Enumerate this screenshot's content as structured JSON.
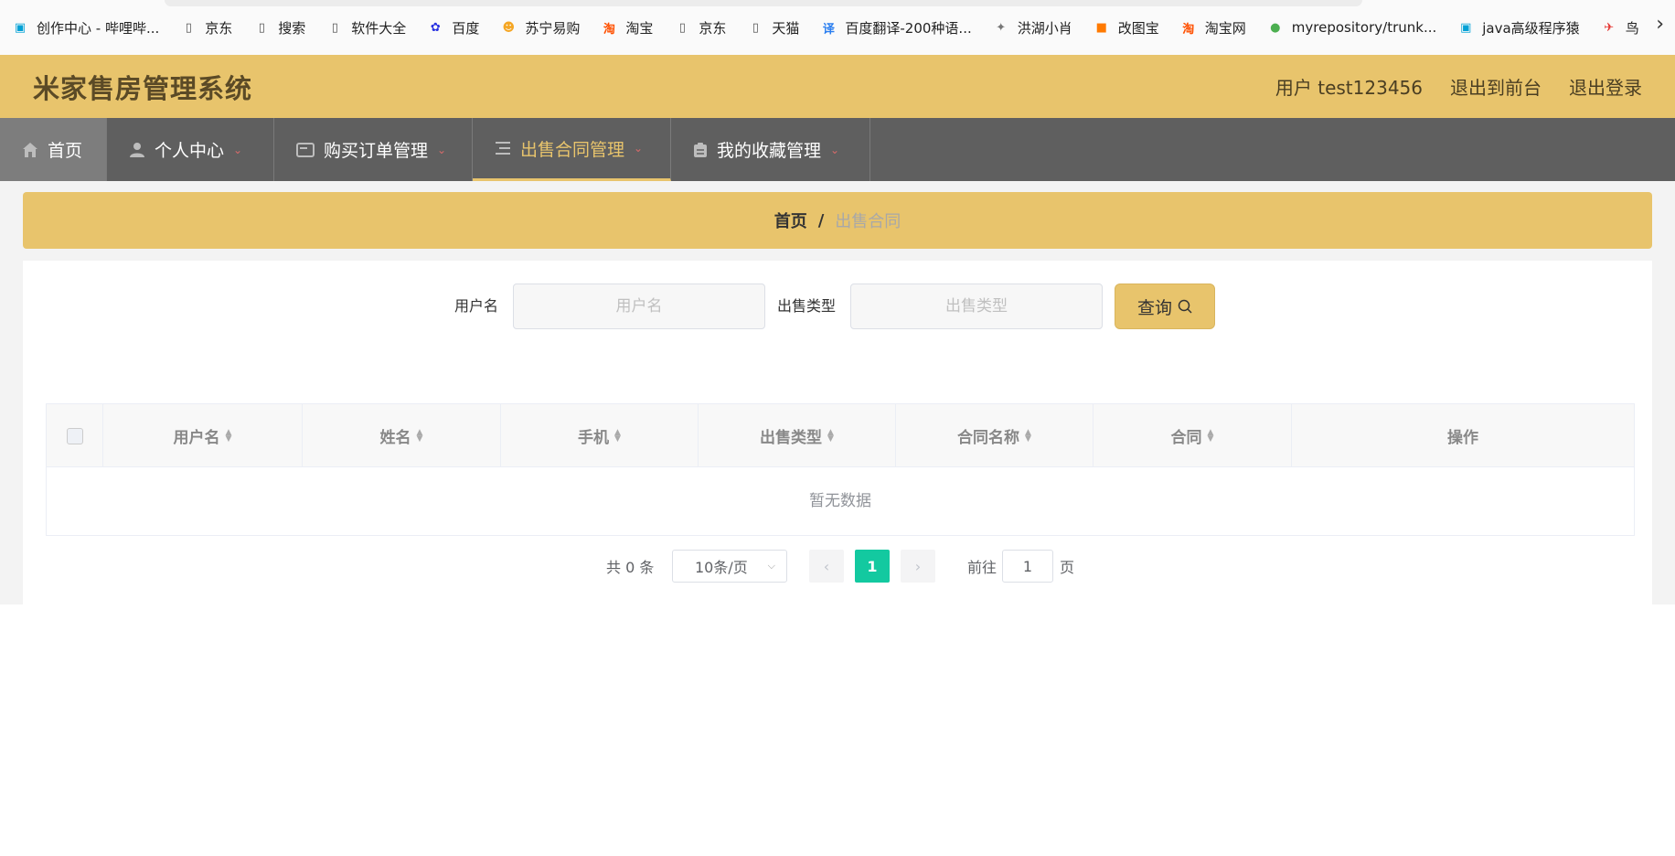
{
  "bookmarks": [
    {
      "label": "创作中心 - 哔哩哔...",
      "icon": "bilibili-icon",
      "color": "#00a1d6"
    },
    {
      "label": "京东",
      "icon": "page-icon",
      "color": "#555"
    },
    {
      "label": "搜索",
      "icon": "page-icon",
      "color": "#555"
    },
    {
      "label": "软件大全",
      "icon": "page-icon",
      "color": "#555"
    },
    {
      "label": "百度",
      "icon": "baidu-icon",
      "color": "#2932e1"
    },
    {
      "label": "苏宁易购",
      "icon": "suning-icon",
      "color": "#f5a623"
    },
    {
      "label": "淘宝",
      "icon": "taobao-icon",
      "color": "#ff5000"
    },
    {
      "label": "京东",
      "icon": "page-icon",
      "color": "#555"
    },
    {
      "label": "天猫",
      "icon": "page-icon",
      "color": "#555"
    },
    {
      "label": "百度翻译-200种语...",
      "icon": "translate-icon",
      "color": "#2a7ef0"
    },
    {
      "label": "洪湖小肖",
      "icon": "bird-icon",
      "color": "#777"
    },
    {
      "label": "改图宝",
      "icon": "gaitubao-icon",
      "color": "#ff7a00"
    },
    {
      "label": "淘宝网",
      "icon": "taobao-icon",
      "color": "#ff5000"
    },
    {
      "label": "myrepository/trunk...",
      "icon": "chrome-icon",
      "color": "#4caf50"
    },
    {
      "label": "java高级程序猿",
      "icon": "bilibili-icon",
      "color": "#00a1d6"
    },
    {
      "label": "鸟",
      "icon": "bird-red-icon",
      "color": "#e53935"
    }
  ],
  "header": {
    "brand": "米家售房管理系统",
    "user": "用户 test123456",
    "to_front": "退出到前台",
    "logout": "退出登录"
  },
  "nav": {
    "home": "首页",
    "personal": "个人中心",
    "orders": "购买订单管理",
    "contracts": "出售合同管理",
    "favorites": "我的收藏管理"
  },
  "breadcrumb": {
    "home": "首页",
    "sep": "/",
    "current": "出售合同"
  },
  "search": {
    "username_label": "用户名",
    "username_placeholder": "用户名",
    "type_label": "出售类型",
    "type_placeholder": "出售类型",
    "query_button": "查询"
  },
  "table": {
    "columns": [
      "用户名",
      "姓名",
      "手机",
      "出售类型",
      "合同名称",
      "合同",
      "操作"
    ],
    "empty_text": "暂无数据"
  },
  "pagination": {
    "total": "共 0 条",
    "page_size": "10条/页",
    "current_page": "1",
    "goto_prefix": "前往",
    "goto_value": "1",
    "goto_suffix": "页"
  },
  "colors": {
    "accent": "#e8c46c",
    "nav_bg": "#5f5f5f",
    "page_active": "#13c9a0"
  }
}
